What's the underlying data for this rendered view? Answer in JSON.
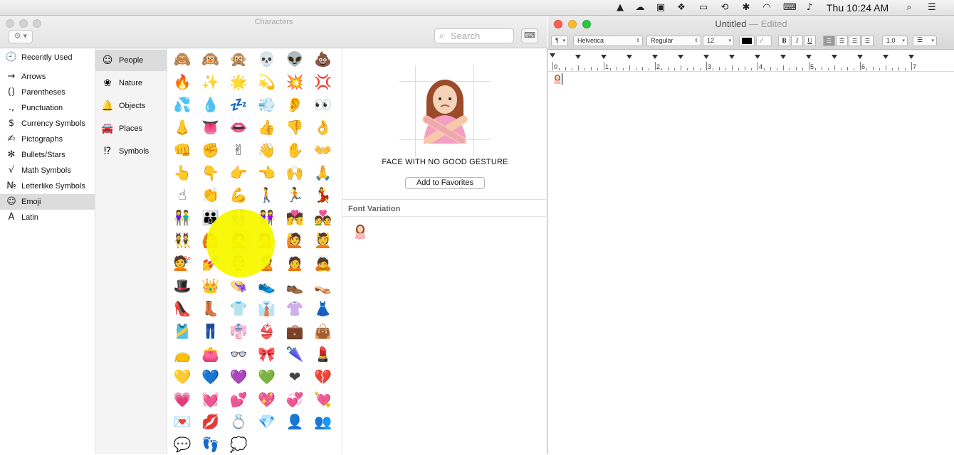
{
  "menubar": {
    "clock": "Thu 10:24 AM",
    "icons": [
      "google-drive-icon",
      "creative-cloud-icon",
      "screen-icon",
      "dropbox-icon",
      "airplay-icon",
      "time-machine-icon",
      "bluetooth-icon",
      "wifi-icon",
      "keyboard-input-icon",
      "volume-icon",
      "spotlight-icon",
      "notification-center-icon"
    ]
  },
  "characters": {
    "title": "Characters",
    "search": {
      "placeholder": "Search",
      "value": ""
    },
    "categories": [
      {
        "icon": "🕘",
        "label": "Recently Used"
      },
      {
        "icon": "→",
        "label": "Arrows"
      },
      {
        "icon": "()",
        "label": "Parentheses"
      },
      {
        "icon": ".,",
        "label": "Punctuation"
      },
      {
        "icon": "$",
        "label": "Currency Symbols"
      },
      {
        "icon": "✍",
        "label": "Pictographs"
      },
      {
        "icon": "✻",
        "label": "Bullets/Stars"
      },
      {
        "icon": "√",
        "label": "Math Symbols"
      },
      {
        "icon": "№",
        "label": "Letterlike Symbols"
      },
      {
        "icon": "☺",
        "label": "Emoji"
      },
      {
        "icon": "A",
        "label": "Latin"
      }
    ],
    "selected_category": "Emoji",
    "subcategories": [
      {
        "icon": "☺",
        "label": "People"
      },
      {
        "icon": "❀",
        "label": "Nature"
      },
      {
        "icon": "🔔",
        "label": "Objects"
      },
      {
        "icon": "🚘",
        "label": "Places"
      },
      {
        "icon": "⁉",
        "label": "Symbols"
      }
    ],
    "selected_subcategory": "People",
    "emoji_rows": [
      [
        "🙈",
        "🙉",
        "🙊",
        "💀",
        "👽",
        "💩"
      ],
      [
        "🔥",
        "✨",
        "🌟",
        "💫",
        "💥",
        "💢"
      ],
      [
        "💦",
        "💧",
        "💤",
        "💨",
        "👂",
        "👀"
      ],
      [
        "👃",
        "👅",
        "👄",
        "👍",
        "👎",
        "👌"
      ],
      [
        "👊",
        "✊",
        "✌",
        "👋",
        "✋",
        "👐"
      ],
      [
        "👆",
        "👇",
        "👉",
        "👈",
        "🙌",
        "🙏"
      ],
      [
        "☝",
        "👏",
        "💪",
        "🚶",
        "🏃",
        "💃"
      ],
      [
        "👫",
        "👪",
        "👬",
        "👭",
        "💏",
        "💑"
      ],
      [
        "👯",
        "🙆",
        "🙅",
        "💁",
        "🙋",
        "💆"
      ],
      [
        "💇",
        "💅",
        "👰",
        "🙎",
        "🙍",
        "🙇"
      ],
      [
        "🎩",
        "👑",
        "👒",
        "👟",
        "👞",
        "👡"
      ],
      [
        "👠",
        "👢",
        "👕",
        "👔",
        "👚",
        "👗"
      ],
      [
        "🎽",
        "👖",
        "👘",
        "👙",
        "💼",
        "👜"
      ],
      [
        "👝",
        "👛",
        "👓",
        "🎀",
        "🌂",
        "💄"
      ],
      [
        "💛",
        "💙",
        "💜",
        "💚",
        "❤",
        "💔"
      ],
      [
        "💗",
        "💓",
        "💕",
        "💖",
        "💞",
        "💘"
      ],
      [
        "💌",
        "💋",
        "💍",
        "💎",
        "👤",
        "👥"
      ],
      [
        "💬",
        "👣",
        "💭"
      ]
    ],
    "selected_emoji": "🙅",
    "selected_name": "FACE WITH NO GOOD GESTURE",
    "add_to_favorites": "Add to Favorites",
    "font_variation_title": "Font Variation"
  },
  "textedit": {
    "title": "Untitled",
    "title_sep": "—",
    "status": "Edited",
    "toolbar": {
      "paragraph": "¶",
      "font_family": "Helvetica",
      "font_style": "Regular",
      "font_size": "12",
      "bold": "B",
      "italic": "I",
      "underline": "U",
      "line_spacing": "1.0",
      "list": "☰"
    },
    "ruler_numbers": [
      "0",
      "1",
      "2",
      "3",
      "4",
      "5",
      "6",
      "7"
    ],
    "document_text": "🙅"
  },
  "colors": {
    "highlight": "#f8f800",
    "close": "#fd5f57",
    "minimize": "#fdbc2e",
    "zoom": "#28c840",
    "inactive_light": "#d3d3d3"
  }
}
